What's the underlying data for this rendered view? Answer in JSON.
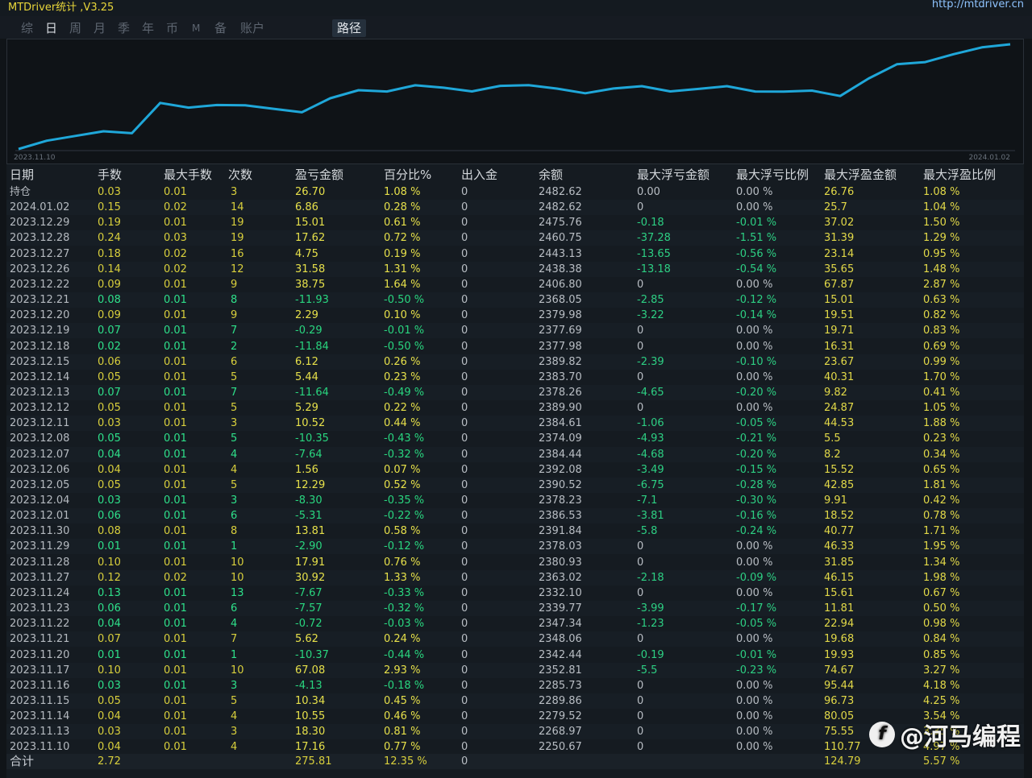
{
  "app": {
    "title": "MTDriver统计 ,V3.25",
    "link": "http://mtdriver.cn"
  },
  "tabs": [
    {
      "label": "综"
    },
    {
      "label": "日"
    },
    {
      "label": "周"
    },
    {
      "label": "月"
    },
    {
      "label": "季"
    },
    {
      "label": "年"
    },
    {
      "label": "币"
    },
    {
      "label": "M"
    },
    {
      "label": "备"
    },
    {
      "label": "账户"
    },
    {
      "label": "路径"
    }
  ],
  "chart": {
    "start_label": "2023.11.10",
    "end_label": "2024.01.02",
    "line_color": "#1fa7d9",
    "series": [
      2250.67,
      2268.97,
      2279.52,
      2289.86,
      2285.73,
      2352.81,
      2342.44,
      2348.06,
      2347.34,
      2339.77,
      2332.1,
      2363.02,
      2380.93,
      2378.03,
      2391.84,
      2386.53,
      2378.23,
      2390.52,
      2392.08,
      2384.44,
      2374.09,
      2384.61,
      2389.9,
      2378.26,
      2383.7,
      2389.82,
      2377.98,
      2377.69,
      2379.98,
      2368.05,
      2406.8,
      2438.38,
      2443.13,
      2460.75,
      2475.76,
      2482.62
    ]
  },
  "table": {
    "headers": [
      "日期",
      "手数",
      "最大手数",
      "次数",
      "盈亏金额",
      "百分比%",
      "出入金",
      "余额",
      "最大浮亏金额",
      "最大浮亏比例",
      "最大浮盈金额",
      "最大浮盈比例"
    ],
    "rows": [
      [
        "持仓",
        "0.03",
        "0.01",
        "3",
        "26.70",
        "1.08 %",
        "0",
        "2482.62",
        "0.00",
        "0.00 %",
        "26.76",
        "1.08 %"
      ],
      [
        "2024.01.02",
        "0.15",
        "0.02",
        "14",
        "6.86",
        "0.28 %",
        "0",
        "2482.62",
        "0",
        "0.00 %",
        "25.7",
        "1.04 %"
      ],
      [
        "2023.12.29",
        "0.19",
        "0.01",
        "19",
        "15.01",
        "0.61 %",
        "0",
        "2475.76",
        "-0.18",
        "-0.01 %",
        "37.02",
        "1.50 %"
      ],
      [
        "2023.12.28",
        "0.24",
        "0.03",
        "19",
        "17.62",
        "0.72 %",
        "0",
        "2460.75",
        "-37.28",
        "-1.51 %",
        "31.39",
        "1.29 %"
      ],
      [
        "2023.12.27",
        "0.18",
        "0.02",
        "16",
        "4.75",
        "0.19 %",
        "0",
        "2443.13",
        "-13.65",
        "-0.56 %",
        "23.14",
        "0.95 %"
      ],
      [
        "2023.12.26",
        "0.14",
        "0.02",
        "12",
        "31.58",
        "1.31 %",
        "0",
        "2438.38",
        "-13.18",
        "-0.54 %",
        "35.65",
        "1.48 %"
      ],
      [
        "2023.12.22",
        "0.09",
        "0.01",
        "9",
        "38.75",
        "1.64 %",
        "0",
        "2406.80",
        "0",
        "0.00 %",
        "67.87",
        "2.87 %"
      ],
      [
        "2023.12.21",
        "0.08",
        "0.01",
        "8",
        "-11.93",
        "-0.50 %",
        "0",
        "2368.05",
        "-2.85",
        "-0.12 %",
        "15.01",
        "0.63 %"
      ],
      [
        "2023.12.20",
        "0.09",
        "0.01",
        "9",
        "2.29",
        "0.10 %",
        "0",
        "2379.98",
        "-3.22",
        "-0.14 %",
        "19.51",
        "0.82 %"
      ],
      [
        "2023.12.19",
        "0.07",
        "0.01",
        "7",
        "-0.29",
        "-0.01 %",
        "0",
        "2377.69",
        "0",
        "0.00 %",
        "19.71",
        "0.83 %"
      ],
      [
        "2023.12.18",
        "0.02",
        "0.01",
        "2",
        "-11.84",
        "-0.50 %",
        "0",
        "2377.98",
        "0",
        "0.00 %",
        "16.31",
        "0.69 %"
      ],
      [
        "2023.12.15",
        "0.06",
        "0.01",
        "6",
        "6.12",
        "0.26 %",
        "0",
        "2389.82",
        "-2.39",
        "-0.10 %",
        "23.67",
        "0.99 %"
      ],
      [
        "2023.12.14",
        "0.05",
        "0.01",
        "5",
        "5.44",
        "0.23 %",
        "0",
        "2383.70",
        "0",
        "0.00 %",
        "40.31",
        "1.70 %"
      ],
      [
        "2023.12.13",
        "0.07",
        "0.01",
        "7",
        "-11.64",
        "-0.49 %",
        "0",
        "2378.26",
        "-4.65",
        "-0.20 %",
        "9.82",
        "0.41 %"
      ],
      [
        "2023.12.12",
        "0.05",
        "0.01",
        "5",
        "5.29",
        "0.22 %",
        "0",
        "2389.90",
        "0",
        "0.00 %",
        "24.87",
        "1.05 %"
      ],
      [
        "2023.12.11",
        "0.03",
        "0.01",
        "3",
        "10.52",
        "0.44 %",
        "0",
        "2384.61",
        "-1.06",
        "-0.05 %",
        "44.53",
        "1.88 %"
      ],
      [
        "2023.12.08",
        "0.05",
        "0.01",
        "5",
        "-10.35",
        "-0.43 %",
        "0",
        "2374.09",
        "-4.93",
        "-0.21 %",
        "5.5",
        "0.23 %"
      ],
      [
        "2023.12.07",
        "0.04",
        "0.01",
        "4",
        "-7.64",
        "-0.32 %",
        "0",
        "2384.44",
        "-4.68",
        "-0.20 %",
        "8.2",
        "0.34 %"
      ],
      [
        "2023.12.06",
        "0.04",
        "0.01",
        "4",
        "1.56",
        "0.07 %",
        "0",
        "2392.08",
        "-3.49",
        "-0.15 %",
        "15.52",
        "0.65 %"
      ],
      [
        "2023.12.05",
        "0.05",
        "0.01",
        "5",
        "12.29",
        "0.52 %",
        "0",
        "2390.52",
        "-6.75",
        "-0.28 %",
        "42.85",
        "1.81 %"
      ],
      [
        "2023.12.04",
        "0.03",
        "0.01",
        "3",
        "-8.30",
        "-0.35 %",
        "0",
        "2378.23",
        "-7.1",
        "-0.30 %",
        "9.91",
        "0.42 %"
      ],
      [
        "2023.12.01",
        "0.06",
        "0.01",
        "6",
        "-5.31",
        "-0.22 %",
        "0",
        "2386.53",
        "-3.81",
        "-0.16 %",
        "18.52",
        "0.78 %"
      ],
      [
        "2023.11.30",
        "0.08",
        "0.01",
        "8",
        "13.81",
        "0.58 %",
        "0",
        "2391.84",
        "-5.8",
        "-0.24 %",
        "40.77",
        "1.71 %"
      ],
      [
        "2023.11.29",
        "0.01",
        "0.01",
        "1",
        "-2.90",
        "-0.12 %",
        "0",
        "2378.03",
        "0",
        "0.00 %",
        "46.33",
        "1.95 %"
      ],
      [
        "2023.11.28",
        "0.10",
        "0.01",
        "10",
        "17.91",
        "0.76 %",
        "0",
        "2380.93",
        "0",
        "0.00 %",
        "31.85",
        "1.34 %"
      ],
      [
        "2023.11.27",
        "0.12",
        "0.02",
        "10",
        "30.92",
        "1.33 %",
        "0",
        "2363.02",
        "-2.18",
        "-0.09 %",
        "46.15",
        "1.98 %"
      ],
      [
        "2023.11.24",
        "0.13",
        "0.01",
        "13",
        "-7.67",
        "-0.33 %",
        "0",
        "2332.10",
        "0",
        "0.00 %",
        "15.61",
        "0.67 %"
      ],
      [
        "2023.11.23",
        "0.06",
        "0.01",
        "6",
        "-7.57",
        "-0.32 %",
        "0",
        "2339.77",
        "-3.99",
        "-0.17 %",
        "11.81",
        "0.50 %"
      ],
      [
        "2023.11.22",
        "0.04",
        "0.01",
        "4",
        "-0.72",
        "-0.03 %",
        "0",
        "2347.34",
        "-1.23",
        "-0.05 %",
        "22.94",
        "0.98 %"
      ],
      [
        "2023.11.21",
        "0.07",
        "0.01",
        "7",
        "5.62",
        "0.24 %",
        "0",
        "2348.06",
        "0",
        "0.00 %",
        "19.68",
        "0.84 %"
      ],
      [
        "2023.11.20",
        "0.01",
        "0.01",
        "1",
        "-10.37",
        "-0.44 %",
        "0",
        "2342.44",
        "-0.19",
        "-0.01 %",
        "19.93",
        "0.85 %"
      ],
      [
        "2023.11.17",
        "0.10",
        "0.01",
        "10",
        "67.08",
        "2.93 %",
        "0",
        "2352.81",
        "-5.5",
        "-0.23 %",
        "74.67",
        "3.27 %"
      ],
      [
        "2023.11.16",
        "0.03",
        "0.01",
        "3",
        "-4.13",
        "-0.18 %",
        "0",
        "2285.73",
        "0",
        "0.00 %",
        "95.44",
        "4.18 %"
      ],
      [
        "2023.11.15",
        "0.05",
        "0.01",
        "5",
        "10.34",
        "0.45 %",
        "0",
        "2289.86",
        "0",
        "0.00 %",
        "96.73",
        "4.25 %"
      ],
      [
        "2023.11.14",
        "0.04",
        "0.01",
        "4",
        "10.55",
        "0.46 %",
        "0",
        "2279.52",
        "0",
        "0.00 %",
        "80.05",
        "3.54 %"
      ],
      [
        "2023.11.13",
        "0.03",
        "0.01",
        "3",
        "18.30",
        "0.81 %",
        "0",
        "2268.97",
        "0",
        "0.00 %",
        "75.55",
        "3.35 %"
      ],
      [
        "2023.11.10",
        "0.04",
        "0.01",
        "4",
        "17.16",
        "0.77 %",
        "0",
        "2250.67",
        "0",
        "0.00 %",
        "110.77",
        "4.97 %"
      ]
    ],
    "total": [
      "合计",
      "2.72",
      "",
      "",
      "275.81",
      "12.35 %",
      "0",
      "",
      "",
      "",
      "124.79",
      "5.57 %"
    ]
  },
  "watermark": {
    "text": "@河马编程"
  }
}
